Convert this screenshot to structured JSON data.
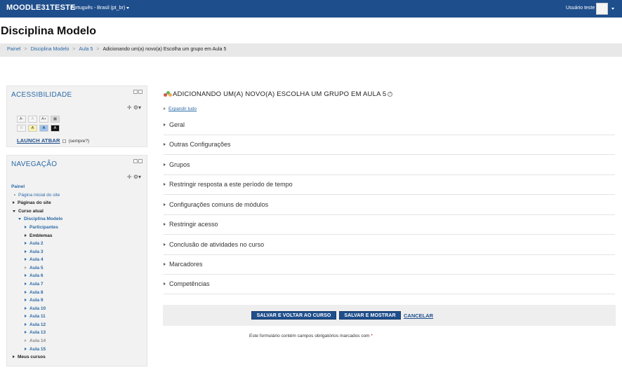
{
  "navbar": {
    "brand": "MOODLE31TESTE",
    "language": "Português - Brasil (pt_br)",
    "user_name": "Usuário teste"
  },
  "page": {
    "title": "Disciplina Modelo"
  },
  "breadcrumb": [
    {
      "label": "Painel",
      "link": true
    },
    {
      "label": "Disciplina Modelo",
      "link": true
    },
    {
      "label": "Aula 5",
      "link": true
    },
    {
      "label": "Adicionando um(a) novo(a) Escolha um grupo em Aula 5",
      "link": false
    }
  ],
  "accessibility": {
    "title": "ACESSIBILIDADE",
    "font_buttons": [
      "A-",
      "A",
      "A+"
    ],
    "color_buttons": [
      "R",
      "A",
      "A",
      "A"
    ],
    "launch_label": "LAUNCH ATBAR",
    "always_label": "(sempre?)"
  },
  "navigation": {
    "title": "NAVEGAÇÃO",
    "items": [
      {
        "label": "Painel"
      },
      {
        "label": "Página inicial do site"
      },
      {
        "label": "Páginas do site"
      },
      {
        "label": "Curso atual"
      },
      {
        "label": "Disciplina Modelo"
      },
      {
        "label": "Participantes"
      },
      {
        "label": "Emblemas"
      },
      {
        "label": "Aula 2"
      },
      {
        "label": "Aula 3"
      },
      {
        "label": "Aula 4"
      },
      {
        "label": "Aula 5"
      },
      {
        "label": "Aula 6"
      },
      {
        "label": "Aula 7"
      },
      {
        "label": "Aula 8"
      },
      {
        "label": "Aula 9"
      },
      {
        "label": "Aula 10"
      },
      {
        "label": "Aula 11"
      },
      {
        "label": "Aula 12"
      },
      {
        "label": "Aula 13"
      },
      {
        "label": "Aula 14"
      },
      {
        "label": "Aula 15"
      },
      {
        "label": "Meus cursos"
      }
    ]
  },
  "main": {
    "heading": "ADICIONANDO UM(A) NOVO(A) ESCOLHA UM GRUPO EM AULA 5",
    "expand_all": "Expandir tudo",
    "sections": [
      "Geral",
      "Outras Configurações",
      "Grupos",
      "Restringir resposta a este período de tempo",
      "Configurações comuns de módulos",
      "Restringir acesso",
      "Conclusão de atividades no curso",
      "Marcadores",
      "Competências"
    ],
    "buttons": {
      "save_return": "SALVAR E VOLTAR AO CURSO",
      "save_show": "SALVAR E MOSTRAR",
      "cancel": "CANCELAR"
    },
    "required_note": "Este formulário contém campos obrigatórios marcados com",
    "required_star": "*"
  },
  "colors": {
    "navbar": "#1f4e8c",
    "link": "#2b6aa7",
    "breadcrumb_bg": "#e8e8e8",
    "block_bg": "#f2f2f2"
  }
}
